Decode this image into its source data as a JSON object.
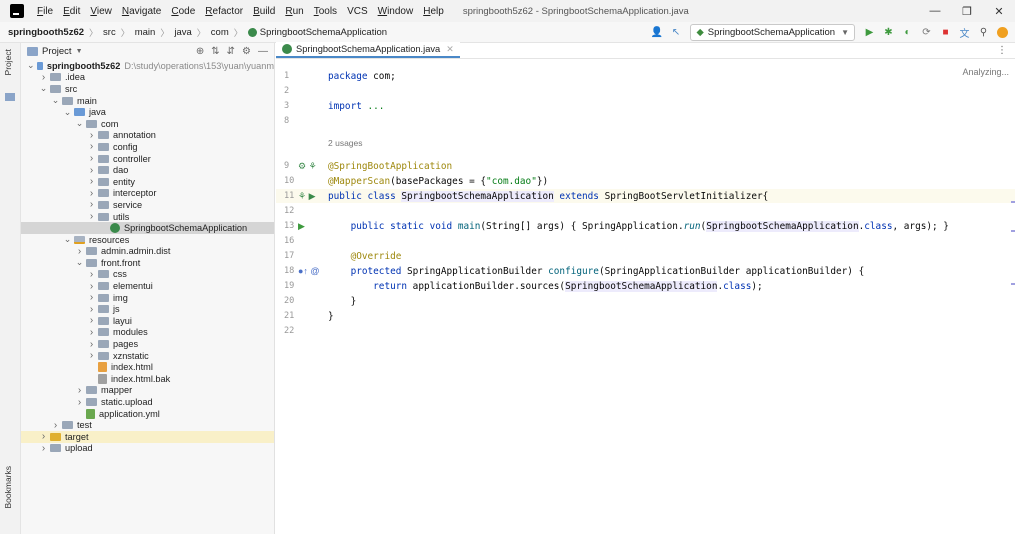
{
  "menubar": {
    "items": [
      {
        "label": "File",
        "mnemonic": "F",
        "rest": "ile"
      },
      {
        "label": "Edit",
        "mnemonic": "E",
        "rest": "dit"
      },
      {
        "label": "View",
        "mnemonic": "V",
        "rest": "iew"
      },
      {
        "label": "Navigate",
        "mnemonic": "N",
        "rest": "avigate"
      },
      {
        "label": "Code",
        "mnemonic": "C",
        "rest": "ode"
      },
      {
        "label": "Refactor",
        "mnemonic": "R",
        "rest": "efactor"
      },
      {
        "label": "Build",
        "mnemonic": "B",
        "rest": "uild"
      },
      {
        "label": "Run",
        "mnemonic": "R",
        "rest": "un"
      },
      {
        "label": "Tools",
        "mnemonic": "T",
        "rest": "ools"
      },
      {
        "label": "VCS",
        "mnemonic": "",
        "rest": "VCS"
      },
      {
        "label": "Window",
        "mnemonic": "W",
        "rest": "indow"
      },
      {
        "label": "Help",
        "mnemonic": "H",
        "rest": "elp"
      }
    ],
    "window_title": "springbooth5z62 - SpringbootSchemaApplication.java",
    "controls": {
      "minimize": "—",
      "maximize": "❐",
      "close": "✕"
    }
  },
  "navbar": {
    "crumbs": [
      "springbooth5z62",
      "src",
      "main",
      "java",
      "com",
      "SpringbootSchemaApplication"
    ],
    "run_config": "SpringbootSchemaApplication"
  },
  "stripes": {
    "project": "Project",
    "bookmarks": "Bookmarks"
  },
  "project_panel": {
    "title": "Project",
    "tree": [
      {
        "label": "springbooth5z62",
        "note": "D:\\study\\operations\\153\\yuan\\yuanm",
        "depth": 0,
        "icon": "module",
        "arrow": "open",
        "bold": true
      },
      {
        "label": ".idea",
        "depth": 1,
        "icon": "folder",
        "arrow": "closed"
      },
      {
        "label": "src",
        "depth": 1,
        "icon": "folder",
        "arrow": "open"
      },
      {
        "label": "main",
        "depth": 2,
        "icon": "folder",
        "arrow": "open"
      },
      {
        "label": "java",
        "depth": 3,
        "icon": "folder-src",
        "arrow": "open"
      },
      {
        "label": "com",
        "depth": 4,
        "icon": "folder-pkg",
        "arrow": "open"
      },
      {
        "label": "annotation",
        "depth": 5,
        "icon": "folder-pkg",
        "arrow": "closed"
      },
      {
        "label": "config",
        "depth": 5,
        "icon": "folder-pkg",
        "arrow": "closed"
      },
      {
        "label": "controller",
        "depth": 5,
        "icon": "folder-pkg",
        "arrow": "closed"
      },
      {
        "label": "dao",
        "depth": 5,
        "icon": "folder-pkg",
        "arrow": "closed"
      },
      {
        "label": "entity",
        "depth": 5,
        "icon": "folder-pkg",
        "arrow": "closed"
      },
      {
        "label": "interceptor",
        "depth": 5,
        "icon": "folder-pkg",
        "arrow": "closed"
      },
      {
        "label": "service",
        "depth": 5,
        "icon": "folder-pkg",
        "arrow": "closed"
      },
      {
        "label": "utils",
        "depth": 5,
        "icon": "folder-pkg",
        "arrow": "closed"
      },
      {
        "label": "SpringbootSchemaApplication",
        "depth": 6,
        "icon": "class-spring",
        "arrow": "none",
        "selected": true
      },
      {
        "label": "resources",
        "depth": 3,
        "icon": "folder-res",
        "arrow": "open"
      },
      {
        "label": "admin.admin.dist",
        "depth": 4,
        "icon": "folder",
        "arrow": "closed"
      },
      {
        "label": "front.front",
        "depth": 4,
        "icon": "folder",
        "arrow": "open"
      },
      {
        "label": "css",
        "depth": 5,
        "icon": "folder",
        "arrow": "closed"
      },
      {
        "label": "elementui",
        "depth": 5,
        "icon": "folder",
        "arrow": "closed"
      },
      {
        "label": "img",
        "depth": 5,
        "icon": "folder",
        "arrow": "closed"
      },
      {
        "label": "js",
        "depth": 5,
        "icon": "folder",
        "arrow": "closed"
      },
      {
        "label": "layui",
        "depth": 5,
        "icon": "folder",
        "arrow": "closed"
      },
      {
        "label": "modules",
        "depth": 5,
        "icon": "folder",
        "arrow": "closed"
      },
      {
        "label": "pages",
        "depth": 5,
        "icon": "folder",
        "arrow": "closed"
      },
      {
        "label": "xznstatic",
        "depth": 5,
        "icon": "folder",
        "arrow": "closed"
      },
      {
        "label": "index.html",
        "depth": 5,
        "icon": "file-html",
        "arrow": "none"
      },
      {
        "label": "index.html.bak",
        "depth": 5,
        "icon": "file-bak",
        "arrow": "none"
      },
      {
        "label": "mapper",
        "depth": 4,
        "icon": "folder",
        "arrow": "closed"
      },
      {
        "label": "static.upload",
        "depth": 4,
        "icon": "folder",
        "arrow": "closed"
      },
      {
        "label": "application.yml",
        "depth": 4,
        "icon": "file-yml",
        "arrow": "none"
      },
      {
        "label": "test",
        "depth": 2,
        "icon": "folder",
        "arrow": "closed"
      },
      {
        "label": "target",
        "depth": 1,
        "icon": "folder-target",
        "arrow": "closed",
        "target": true
      },
      {
        "label": "upload",
        "depth": 1,
        "icon": "folder",
        "arrow": "closed"
      }
    ]
  },
  "editor": {
    "tab": "SpringbootSchemaApplication.java",
    "status": "Analyzing...",
    "usages": "2 usages",
    "lines": [
      {
        "n": "1",
        "segs": [
          [
            "kw",
            "package "
          ],
          [
            "",
            "com;"
          ]
        ]
      },
      {
        "n": "2",
        "segs": []
      },
      {
        "n": "3",
        "segs": [
          [
            "kw",
            "import "
          ],
          [
            "str",
            "..."
          ]
        ]
      },
      {
        "n": "8",
        "segs": []
      },
      {
        "n": "9",
        "segs": [
          [
            "ann",
            "@SpringBootApplication"
          ]
        ],
        "icons": "bean"
      },
      {
        "n": "10",
        "segs": [
          [
            "ann",
            "@MapperScan"
          ],
          [
            "",
            "(basePackages = {"
          ],
          [
            "str",
            "\"com.dao\""
          ],
          [
            "",
            "})"
          ]
        ]
      },
      {
        "n": "11",
        "segs": [
          [
            "kw",
            "public class "
          ],
          [
            "hl",
            "SpringbootSchemaApplication"
          ],
          [
            "kw",
            " extends "
          ],
          [
            "",
            "SpringBootServletInitializer{"
          ]
        ],
        "icons": "run",
        "caret": true
      },
      {
        "n": "12",
        "segs": []
      },
      {
        "n": "13",
        "segs": [
          [
            "kw",
            "    public static void "
          ],
          [
            "fn",
            "main"
          ],
          [
            "",
            "(String[] args) { SpringApplication."
          ],
          [
            "fn-it",
            "run"
          ],
          [
            "",
            "("
          ],
          [
            "hl",
            "SpringbootSchemaApplication"
          ],
          [
            "",
            "."
          ],
          [
            "kw",
            "class"
          ],
          [
            "",
            ", args); }"
          ]
        ],
        "icons": "play"
      },
      {
        "n": "16",
        "segs": []
      },
      {
        "n": "17",
        "segs": [
          [
            "ann",
            "    @Override"
          ]
        ]
      },
      {
        "n": "18",
        "segs": [
          [
            "kw",
            "    protected "
          ],
          [
            "",
            "SpringApplicationBuilder "
          ],
          [
            "fn",
            "configure"
          ],
          [
            "",
            "(SpringApplicationBuilder applicationBuilder) {"
          ]
        ],
        "icons": "override"
      },
      {
        "n": "19",
        "segs": [
          [
            "kw",
            "        return "
          ],
          [
            "",
            "applicationBuilder.sources("
          ],
          [
            "hl",
            "SpringbootSchemaApplication"
          ],
          [
            "",
            "."
          ],
          [
            "kw",
            "class"
          ],
          [
            "",
            ");"
          ]
        ]
      },
      {
        "n": "20",
        "segs": [
          [
            "",
            "    }"
          ]
        ]
      },
      {
        "n": "21",
        "segs": [
          [
            "",
            "}"
          ]
        ]
      },
      {
        "n": "22",
        "segs": []
      }
    ]
  }
}
